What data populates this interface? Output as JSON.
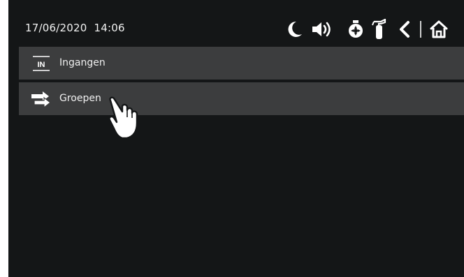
{
  "status_bar": {
    "date": "17/06/2020",
    "time": "14:06",
    "icons": [
      "night-mode-moon-icon",
      "speaker-volume-icon",
      "ventilation-fan-icon",
      "fire-extinguisher-icon",
      "back-chevron-icon",
      "home-icon"
    ]
  },
  "menu": {
    "items": [
      {
        "label": "Ingangen",
        "icon": "inputs-in-icon",
        "icon_text": "IN"
      },
      {
        "label": "Groepen",
        "icon": "groups-arrows-icon"
      }
    ]
  },
  "colors": {
    "background": "#141617",
    "menu_item": "#3c3d3e",
    "text": "#f0f0f0"
  }
}
